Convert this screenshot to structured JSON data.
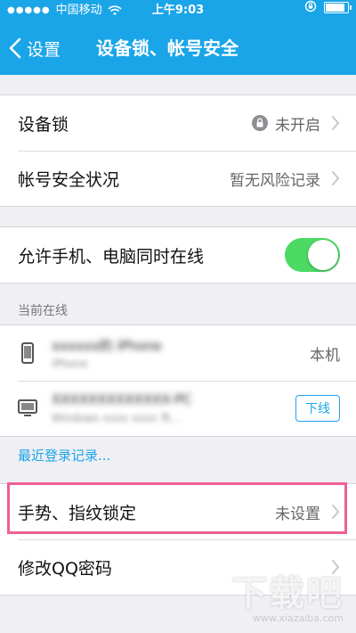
{
  "statusbar": {
    "carrier": "中国移动",
    "time": "上午9:03"
  },
  "nav": {
    "back_label": "设置",
    "title": "设备锁、帐号安全"
  },
  "security": {
    "device_lock_label": "设备锁",
    "device_lock_value": "未开启",
    "account_status_label": "帐号安全状况",
    "account_status_value": "暂无风险记录"
  },
  "online": {
    "allow_label": "允许手机、电脑同时在线",
    "allow_on": true,
    "header": "当前在线",
    "devices": [
      {
        "name": "xxxxxx的 iPhone",
        "detail": "iPhone",
        "tag": "本机"
      },
      {
        "name": "XXXXXXXXXXXXX-PC",
        "detail": "Windows xxxx xxxx 市...",
        "action": "下线"
      }
    ],
    "recent_link": "最近登录记录..."
  },
  "lock": {
    "gesture_label": "手势、指纹锁定",
    "gesture_value": "未设置",
    "password_label": "修改QQ密码"
  },
  "watermark": {
    "big": "下载吧",
    "small": "www.xiazaiba.com"
  },
  "colors": {
    "accent": "#1aa5e8",
    "toggle_on": "#4cd964",
    "highlight": "#ef5f92"
  }
}
